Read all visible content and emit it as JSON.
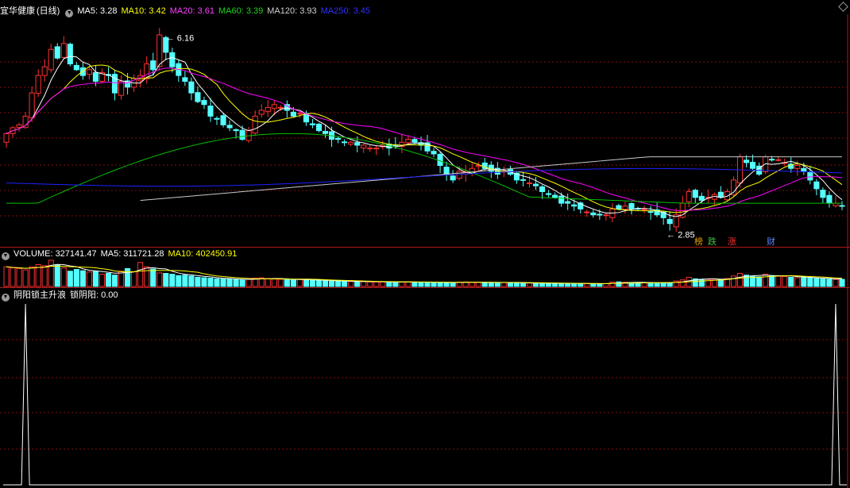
{
  "stock_header": {
    "name": "宜华健康",
    "period": "(日线)",
    "ma5": "MA5: 3.28",
    "ma10": "MA10: 3.42",
    "ma20": "MA20: 3.61",
    "ma60": "MA60: 3.39",
    "ma120": "MA120: 3.93",
    "ma250": "MA250: 3.45"
  },
  "volume_header": {
    "label": "VOLUME: 327141.47",
    "ma5": "MA5: 311721.28",
    "ma10": "MA10: 402450.91"
  },
  "indicator_header": {
    "name": "阴阳锁主升浪",
    "value": "锁阴阳: 0.00"
  },
  "annotations": {
    "high": "6.16",
    "low": "2.85"
  },
  "events": [
    {
      "label": "榜",
      "color": "#e0a000"
    },
    {
      "label": "跌",
      "color": "#40c040"
    },
    {
      "label": "涨",
      "color": "#ff3030"
    },
    {
      "label": "财",
      "color": "#6080ff"
    }
  ],
  "colors": {
    "up": "#ff3030",
    "down": "#54ffff",
    "ma5": "#ffffff",
    "ma10": "#ffff00",
    "ma20": "#ff00ff",
    "ma60": "#00c000",
    "ma120": "#c8c8c8",
    "ma250": "#2020ff",
    "grid": "#801010"
  },
  "chart_data": [
    {
      "type": "candlestick",
      "title": "宜华健康 (日线)",
      "y_range": [
        2.6,
        6.4
      ],
      "highest_marked": 6.16,
      "lowest_marked": 2.85,
      "series": [
        {
          "name": "MA5",
          "last": 3.28
        },
        {
          "name": "MA10",
          "last": 3.42
        },
        {
          "name": "MA20",
          "last": 3.61
        },
        {
          "name": "MA60",
          "last": 3.39
        },
        {
          "name": "MA120",
          "last": 3.93
        },
        {
          "name": "MA250",
          "last": 3.45
        }
      ],
      "close": [
        4.4,
        4.5,
        4.55,
        4.7,
        5.1,
        5.4,
        5.55,
        5.85,
        5.7,
        5.95,
        5.6,
        5.5,
        5.4,
        5.5,
        5.3,
        5.45,
        5.4,
        5.1,
        5.3,
        5.2,
        5.35,
        5.4,
        5.6,
        5.5,
        6.1,
        5.8,
        5.55,
        5.4,
        5.3,
        5.1,
        4.95,
        4.9,
        4.7,
        4.65,
        4.55,
        4.5,
        4.45,
        4.3,
        4.45,
        4.7,
        4.8,
        4.85,
        4.9,
        4.85,
        4.8,
        4.7,
        4.75,
        4.6,
        4.55,
        4.45,
        4.4,
        4.3,
        4.3,
        4.25,
        4.25,
        4.2,
        4.2,
        4.15,
        4.15,
        4.2,
        4.15,
        4.2,
        4.25,
        4.3,
        4.25,
        4.2,
        4.1,
        4.05,
        3.85,
        3.7,
        3.6,
        3.75,
        3.75,
        3.8,
        3.85,
        3.8,
        3.75,
        3.7,
        3.75,
        3.7,
        3.6,
        3.6,
        3.55,
        3.5,
        3.4,
        3.35,
        3.3,
        3.2,
        3.2,
        3.15,
        3.1,
        3.05,
        3.0,
        3.0,
        3.0,
        3.1,
        3.1,
        3.15,
        3.1,
        3.1,
        3.1,
        3.05,
        3.0,
        2.95,
        2.85,
        3.0,
        3.2,
        3.4,
        3.3,
        3.25,
        3.3,
        3.35,
        3.3,
        3.4,
        3.6,
        4.0,
        3.9,
        3.8,
        3.7,
        4.0,
        3.95,
        3.95,
        3.9,
        3.8,
        3.85,
        3.75,
        3.6,
        3.45,
        3.3,
        3.2,
        3.2,
        3.15
      ]
    },
    {
      "type": "bar",
      "title": "VOLUME",
      "series": [
        {
          "name": "VOLUME",
          "last": 327141.47
        },
        {
          "name": "MA5",
          "last": 311721.28
        },
        {
          "name": "MA10",
          "last": 402450.91
        }
      ],
      "values": [
        900000,
        850000,
        820000,
        760000,
        900000,
        1000000,
        950000,
        1200000,
        1000000,
        850000,
        700000,
        780000,
        720000,
        660000,
        700000,
        560000,
        600000,
        520000,
        700000,
        820000,
        680000,
        1100000,
        900000,
        800000,
        620000,
        600000,
        560000,
        500000,
        520000,
        480000,
        420000,
        400000,
        380000,
        350000,
        340000,
        340000,
        320000,
        300000,
        330000,
        380000,
        400000,
        360000,
        340000,
        330000,
        310000,
        300000,
        320000,
        300000,
        280000,
        270000,
        260000,
        250000,
        240000,
        230000,
        230000,
        220000,
        220000,
        210000,
        210000,
        210000,
        200000,
        200000,
        205000,
        210000,
        200000,
        190000,
        190000,
        185000,
        180000,
        175000,
        170000,
        200000,
        210000,
        200000,
        190000,
        185000,
        180000,
        175000,
        175000,
        170000,
        165000,
        160000,
        155000,
        150000,
        150000,
        145000,
        140000,
        140000,
        135000,
        135000,
        130000,
        130000,
        125000,
        125000,
        130000,
        200000,
        210000,
        190000,
        180000,
        170000,
        175000,
        180000,
        170000,
        165000,
        160000,
        250000,
        300000,
        420000,
        350000,
        330000,
        320000,
        340000,
        330000,
        360000,
        480000,
        600000,
        520000,
        480000,
        440000,
        560000,
        500000,
        480000,
        460000,
        420000,
        400000,
        420000,
        380000,
        360000,
        340000,
        330000,
        320000,
        327141.47
      ]
    },
    {
      "type": "line",
      "title": "阴阳锁主升浪",
      "series": [
        {
          "name": "锁阴阳",
          "last": 0.0
        }
      ],
      "spikes_at_index": [
        3,
        130
      ]
    }
  ]
}
